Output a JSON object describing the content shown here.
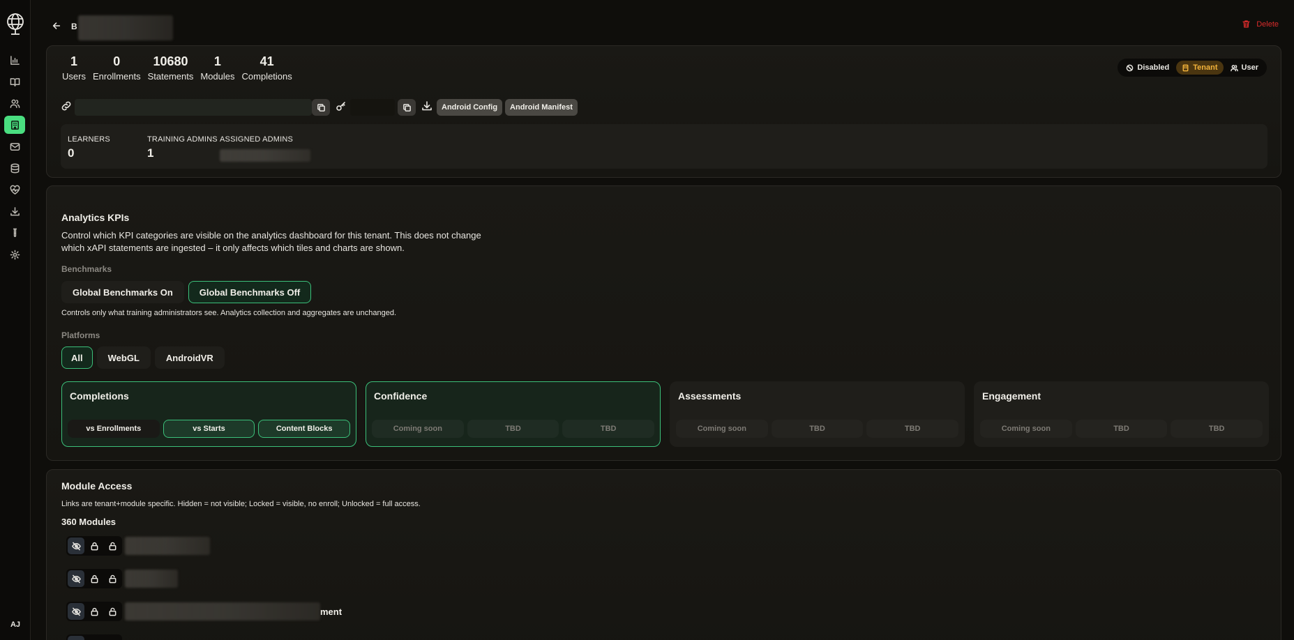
{
  "header": {
    "title_initial": "B",
    "delete_label": "Delete"
  },
  "sidebar": {
    "items": [
      {
        "icon": "bar-chart-icon"
      },
      {
        "icon": "book-icon"
      },
      {
        "icon": "users-icon"
      },
      {
        "icon": "building-icon",
        "active": true
      },
      {
        "icon": "mail-icon"
      },
      {
        "icon": "database-icon"
      },
      {
        "icon": "heart-pulse-icon"
      },
      {
        "icon": "download-icon"
      },
      {
        "icon": "test-tube-icon"
      },
      {
        "icon": "gear-icon"
      }
    ],
    "avatar": "AJ"
  },
  "stats": [
    {
      "value": "1",
      "label": "Users"
    },
    {
      "value": "0",
      "label": "Enrollments"
    },
    {
      "value": "10680",
      "label": "Statements"
    },
    {
      "value": "1",
      "label": "Modules"
    },
    {
      "value": "41",
      "label": "Completions"
    }
  ],
  "mode_toggle": {
    "options": [
      "Disabled",
      "Tenant",
      "User"
    ],
    "selected": "Tenant"
  },
  "links": {
    "android_config": "Android Config",
    "android_manifest": "Android Manifest"
  },
  "roles": [
    {
      "label": "LEARNERS",
      "value": "0"
    },
    {
      "label": "TRAINING ADMINS",
      "value": "1"
    },
    {
      "label": "ASSIGNED ADMINS",
      "value": ""
    }
  ],
  "analytics": {
    "title": "Analytics KPIs",
    "desc_line1": "Control which KPI categories are visible on the analytics dashboard for this tenant. This does not change",
    "desc_line2": "which xAPI statements are ingested – it only affects which tiles and charts are shown.",
    "benchmarks_label": "Benchmarks",
    "benchmarks_options": [
      "Global Benchmarks On",
      "Global Benchmarks Off"
    ],
    "benchmarks_selected": "Global Benchmarks Off",
    "benchmarks_note": "Controls only what training administrators see. Analytics collection and aggregates are unchanged.",
    "platforms_label": "Platforms",
    "platform_options": [
      "All",
      "WebGL",
      "AndroidVR"
    ],
    "platform_selected": "All",
    "kpis": [
      {
        "title": "Completions",
        "enabled": true,
        "options": [
          {
            "label": "vs Enrollments",
            "selected": false
          },
          {
            "label": "vs Starts",
            "selected": true
          },
          {
            "label": "Content Blocks",
            "selected": true
          }
        ]
      },
      {
        "title": "Confidence",
        "enabled": true,
        "options": [
          {
            "label": "Coming soon",
            "disabled": true
          },
          {
            "label": "TBD",
            "disabled": true
          },
          {
            "label": "TBD",
            "disabled": true
          }
        ]
      },
      {
        "title": "Assessments",
        "enabled": false,
        "options": [
          {
            "label": "Coming soon",
            "disabled": true
          },
          {
            "label": "TBD",
            "disabled": true
          },
          {
            "label": "TBD",
            "disabled": true
          }
        ]
      },
      {
        "title": "Engagement",
        "enabled": false,
        "options": [
          {
            "label": "Coming soon",
            "disabled": true
          },
          {
            "label": "TBD",
            "disabled": true
          },
          {
            "label": "TBD",
            "disabled": true
          }
        ]
      }
    ]
  },
  "module_access": {
    "title": "Module Access",
    "desc": "Links are tenant+module specific. Hidden = not visible; Locked = visible, no enroll; Unlocked = full access.",
    "group_label": "360 Modules",
    "rows": [
      {
        "state": "hidden",
        "name_suffix": ""
      },
      {
        "state": "hidden",
        "name_suffix": ""
      },
      {
        "state": "hidden",
        "name_suffix": "ment"
      }
    ]
  }
}
